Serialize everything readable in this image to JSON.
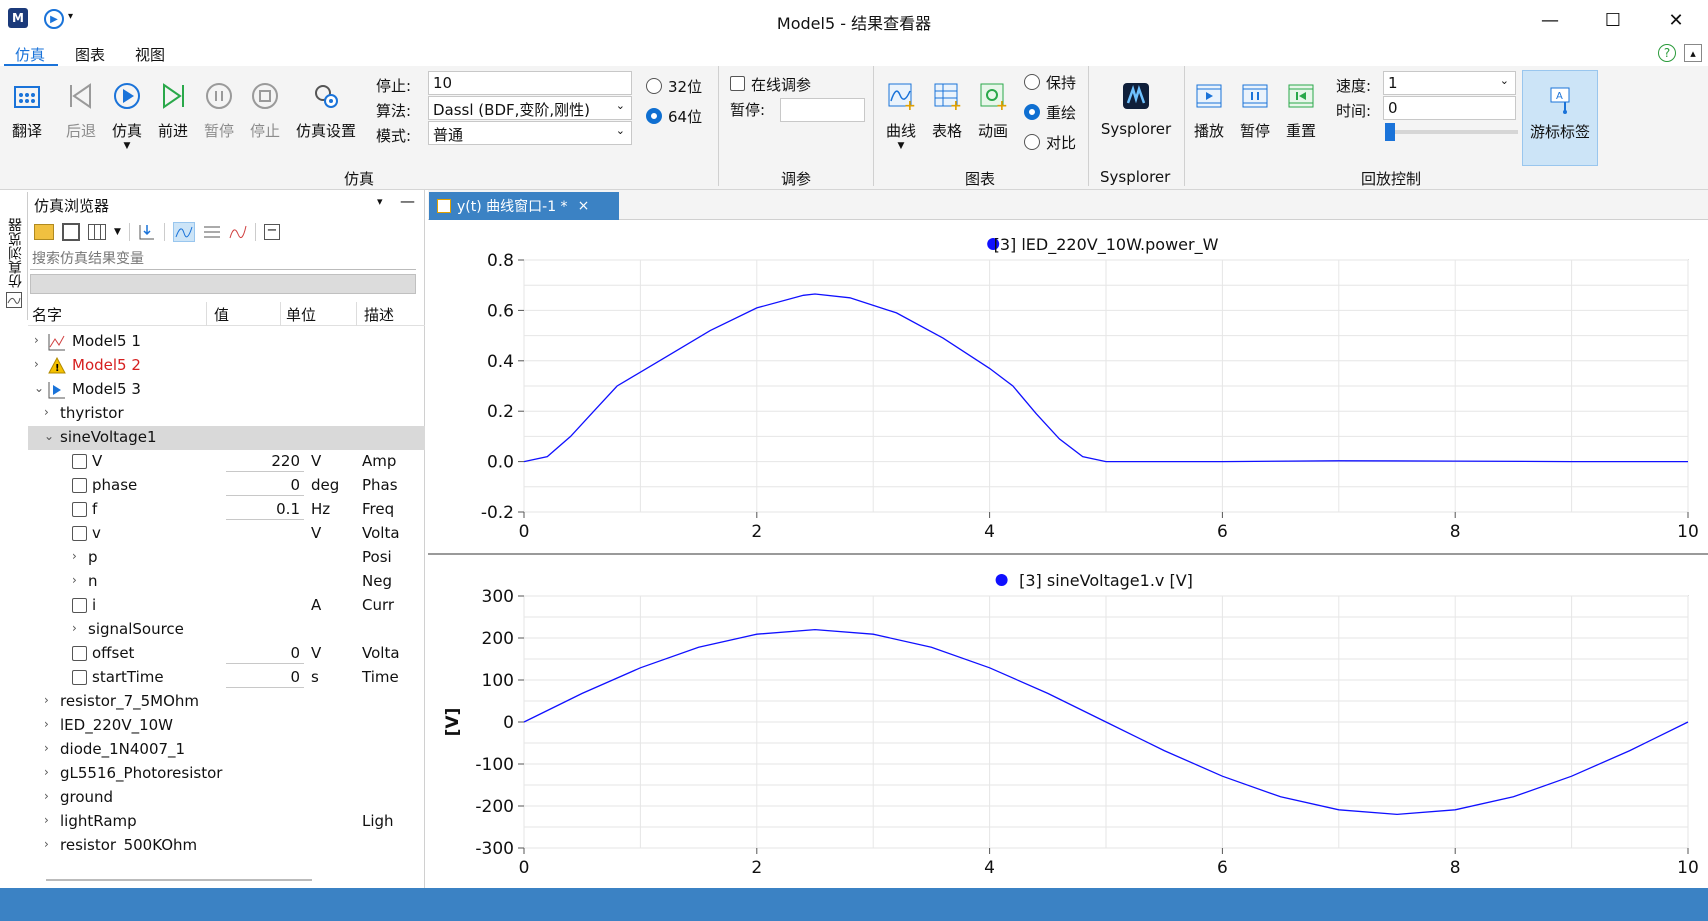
{
  "window": {
    "title": "Model5 - 结果查看器",
    "minimize": "—",
    "maximize": "☐",
    "close": "✕"
  },
  "menu": {
    "items": [
      "仿真",
      "图表",
      "视图"
    ]
  },
  "ribbon": {
    "sim_buttons": [
      "翻译",
      "后退",
      "仿真",
      "前进",
      "暂停",
      "停止",
      "仿真设置"
    ],
    "stop_label": "停止:",
    "stop_value": "10",
    "algo_label": "算法:",
    "algo_value": "Dassl (BDF,变阶,刚性)",
    "mode_label": "模式:",
    "mode_value": "普通",
    "bit32": "32位",
    "bit64": "64位",
    "sim_group": "仿真",
    "online_tune": "在线调参",
    "pause_label": "暂停:",
    "tune_group": "调参",
    "chart_buttons": [
      "曲线",
      "表格",
      "动画"
    ],
    "chart_group": "图表",
    "keep": "保持",
    "redraw": "重绘",
    "compare": "对比",
    "sysplorer": "Sysplorer",
    "sysplorer_group": "Sysplorer",
    "playback_buttons": [
      "播放",
      "暂停",
      "重置"
    ],
    "speed_label": "速度:",
    "speed_value": "1",
    "time_label": "时间:",
    "time_value": "0",
    "cursor_label": "游标标签",
    "playback_group": "回放控制"
  },
  "side_tab": "仿真浏览器",
  "browser": {
    "title": "仿真浏览器",
    "search_placeholder": "搜索仿真结果变量",
    "columns": [
      "名字",
      "值",
      "单位",
      "描述"
    ],
    "rows": [
      {
        "level": 0,
        "arrow": "›",
        "label": "Model5 1",
        "value": "",
        "unit": "",
        "desc": "",
        "icon": "plot",
        "check": false
      },
      {
        "level": 0,
        "arrow": "›",
        "label": "Model5 2",
        "value": "",
        "unit": "",
        "desc": "",
        "icon": "warn",
        "check": false,
        "red": true
      },
      {
        "level": 0,
        "arrow": "⌄",
        "label": "Model5 3",
        "value": "",
        "unit": "",
        "desc": "",
        "icon": "run",
        "check": false
      },
      {
        "level": 1,
        "arrow": "›",
        "label": "thyristor",
        "value": "",
        "unit": "",
        "desc": "",
        "check": false
      },
      {
        "level": 1,
        "arrow": "⌄",
        "label": "sineVoltage1",
        "value": "",
        "unit": "",
        "desc": "",
        "check": false,
        "selected": true
      },
      {
        "level": 2,
        "arrow": "",
        "label": "V",
        "value": "220",
        "unit": "V",
        "desc": "Amp",
        "check": true
      },
      {
        "level": 2,
        "arrow": "",
        "label": "phase",
        "value": "0",
        "unit": "deg",
        "desc": "Phas",
        "check": true
      },
      {
        "level": 2,
        "arrow": "",
        "label": "f",
        "value": "0.1",
        "unit": "Hz",
        "desc": "Freq",
        "check": true
      },
      {
        "level": 2,
        "arrow": "",
        "label": "v",
        "value": "",
        "unit": "V",
        "desc": "Volta",
        "check": true
      },
      {
        "level": 2,
        "arrow": "›",
        "label": "p",
        "value": "",
        "unit": "",
        "desc": "Posi",
        "check": false
      },
      {
        "level": 2,
        "arrow": "›",
        "label": "n",
        "value": "",
        "unit": "",
        "desc": "Neg",
        "check": false
      },
      {
        "level": 2,
        "arrow": "",
        "label": "i",
        "value": "",
        "unit": "A",
        "desc": "Curr",
        "check": true
      },
      {
        "level": 2,
        "arrow": "›",
        "label": "signalSource",
        "value": "",
        "unit": "",
        "desc": "",
        "check": false
      },
      {
        "level": 2,
        "arrow": "",
        "label": "offset",
        "value": "0",
        "unit": "V",
        "desc": "Volta",
        "check": true
      },
      {
        "level": 2,
        "arrow": "",
        "label": "startTime",
        "value": "0",
        "unit": "s",
        "desc": "Time",
        "check": true
      },
      {
        "level": 1,
        "arrow": "›",
        "label": "resistor_7_5MOhm",
        "value": "",
        "unit": "",
        "desc": "",
        "check": false
      },
      {
        "level": 1,
        "arrow": "›",
        "label": "lED_220V_10W",
        "value": "",
        "unit": "",
        "desc": "",
        "check": false
      },
      {
        "level": 1,
        "arrow": "›",
        "label": "diode_1N4007_1",
        "value": "",
        "unit": "",
        "desc": "",
        "check": false
      },
      {
        "level": 1,
        "arrow": "›",
        "label": "gL5516_Photoresistor",
        "value": "",
        "unit": "",
        "desc": "",
        "check": false
      },
      {
        "level": 1,
        "arrow": "›",
        "label": "ground",
        "value": "",
        "unit": "",
        "desc": "",
        "check": false
      },
      {
        "level": 1,
        "arrow": "›",
        "label": "lightRamp",
        "value": "",
        "unit": "",
        "desc": "Ligh",
        "check": false
      },
      {
        "level": 1,
        "arrow": "›",
        "label": "resistor_500KOhm",
        "value": "",
        "unit": "",
        "desc": "",
        "check": false
      }
    ]
  },
  "tab": {
    "label": "y(t) 曲线窗口-1 *",
    "close": "×"
  },
  "colors": {
    "series": "#1010ff",
    "ribbon_active": "#cce4f7",
    "status": "#3b82c4"
  },
  "chart_data": [
    {
      "type": "line",
      "title": "[3] lED_220V_10W.power_W",
      "ylabel": "",
      "xlim": [
        0,
        10
      ],
      "ylim": [
        -0.2,
        0.8
      ],
      "xticks": [
        0,
        2,
        4,
        6,
        8,
        10
      ],
      "yticks": [
        -0.2,
        0.0,
        0.2,
        0.4,
        0.6,
        0.8
      ],
      "ytick_labels": [
        "-0.2",
        "0.0",
        "0.2",
        "0.4",
        "0.6",
        "0.8"
      ],
      "grid": true,
      "series": [
        {
          "name": "[3] lED_220V_10W.power_W",
          "x": [
            0,
            0.2,
            0.4,
            0.6,
            0.8,
            1.2,
            1.6,
            2.0,
            2.4,
            2.5,
            2.8,
            3.2,
            3.6,
            4.0,
            4.2,
            4.4,
            4.6,
            4.8,
            5.0,
            6.0,
            7.0,
            8.0,
            9.0,
            10.0
          ],
          "y": [
            0,
            0.02,
            0.1,
            0.2,
            0.3,
            0.41,
            0.52,
            0.61,
            0.66,
            0.665,
            0.65,
            0.59,
            0.49,
            0.37,
            0.3,
            0.19,
            0.09,
            0.02,
            0.0,
            0.0,
            0.003,
            0.002,
            0.0,
            0.0
          ]
        }
      ]
    },
    {
      "type": "line",
      "title": "[3] sineVoltage1.v [V]",
      "ylabel": "[V]",
      "xlim": [
        0,
        10
      ],
      "ylim": [
        -300,
        300
      ],
      "xticks": [
        0,
        2,
        4,
        6,
        8,
        10
      ],
      "yticks": [
        -300,
        -200,
        -100,
        0,
        100,
        200,
        300
      ],
      "ytick_labels": [
        "-300",
        "-200",
        "-100",
        "0",
        "100",
        "200",
        "300"
      ],
      "grid": true,
      "series": [
        {
          "name": "[3] sineVoltage1.v [V]",
          "x": [
            0,
            0.5,
            1,
            1.5,
            2,
            2.5,
            3,
            3.5,
            4,
            4.5,
            5,
            5.5,
            6,
            6.5,
            7,
            7.5,
            8,
            8.5,
            9,
            9.5,
            10
          ],
          "y": [
            0,
            68,
            129,
            178,
            209,
            220,
            209,
            178,
            129,
            68,
            0,
            -68,
            -129,
            -178,
            -209,
            -220,
            -209,
            -178,
            -129,
            -68,
            0
          ]
        }
      ]
    }
  ]
}
